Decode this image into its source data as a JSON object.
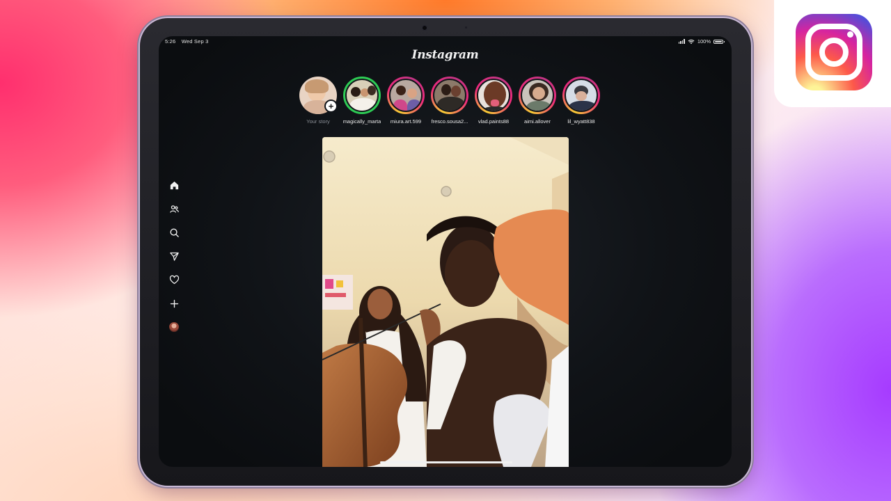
{
  "status_bar": {
    "time": "5:26",
    "date": "Wed Sep 3",
    "battery": "100%",
    "battery_level": 1.0
  },
  "app": {
    "title": "Instagram"
  },
  "stories": [
    {
      "username": "Your story",
      "ring": "none",
      "is_own": true
    },
    {
      "username": "magically_marta",
      "ring": "close-friends"
    },
    {
      "username": "miura.art.599",
      "ring": "gradient"
    },
    {
      "username": "fresco.sousa2...",
      "ring": "gradient"
    },
    {
      "username": "vlad.paints88",
      "ring": "gradient"
    },
    {
      "username": "aimi.allover",
      "ring": "gradient"
    },
    {
      "username": "lil_wyatt838",
      "ring": "gradient"
    }
  ],
  "sidebar": {
    "items": [
      {
        "name": "home",
        "icon": "home-icon",
        "active": true
      },
      {
        "name": "friends",
        "icon": "people-icon"
      },
      {
        "name": "search",
        "icon": "search-icon"
      },
      {
        "name": "messages",
        "icon": "send-icon"
      },
      {
        "name": "activity",
        "icon": "heart-icon"
      },
      {
        "name": "create",
        "icon": "plus-icon"
      },
      {
        "name": "profile",
        "icon": "avatar"
      }
    ]
  },
  "post": {
    "media": "photo"
  },
  "colors": {
    "screen_bg": "#101317",
    "close_friends_ring": "#2ecc55",
    "story_gradient": [
      "#f9ce34",
      "#ee2a7b",
      "#c13584"
    ],
    "text": "#e9e9e9",
    "muted_text": "#8a8f96"
  }
}
